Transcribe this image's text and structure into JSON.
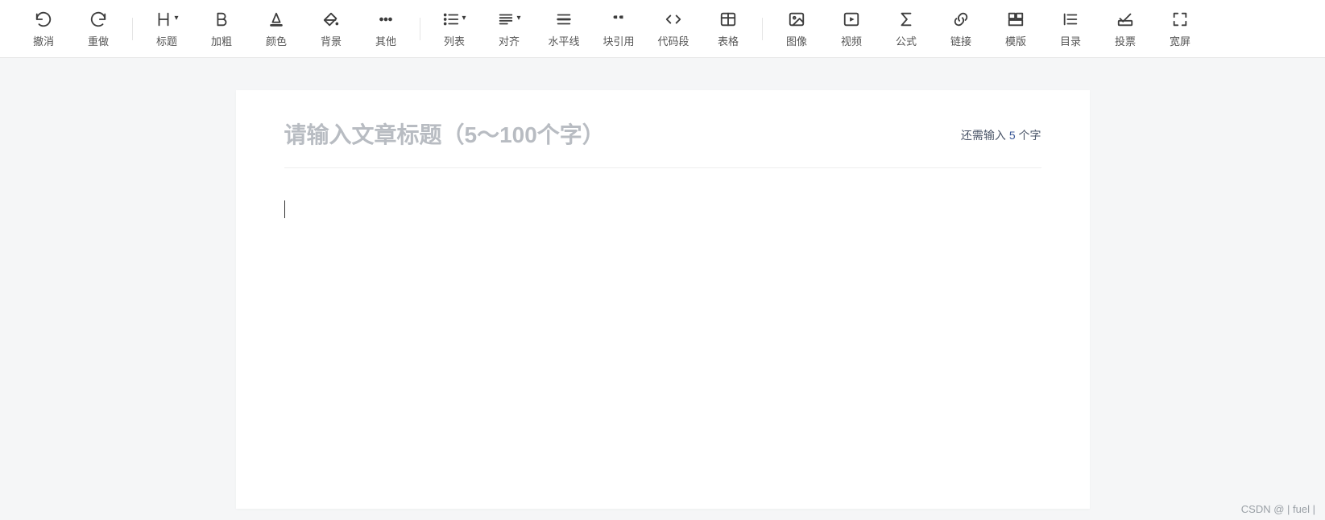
{
  "toolbar": {
    "groups": [
      [
        {
          "id": "undo",
          "label": "撤消",
          "icon": "undo"
        },
        {
          "id": "redo",
          "label": "重做",
          "icon": "redo"
        }
      ],
      [
        {
          "id": "heading",
          "label": "标题",
          "icon": "heading",
          "dropdown": true
        },
        {
          "id": "bold",
          "label": "加粗",
          "icon": "bold"
        },
        {
          "id": "color",
          "label": "颜色",
          "icon": "font-color"
        },
        {
          "id": "bg",
          "label": "背景",
          "icon": "paint-bucket"
        },
        {
          "id": "other",
          "label": "其他",
          "icon": "more"
        }
      ],
      [
        {
          "id": "list",
          "label": "列表",
          "icon": "list",
          "dropdown": true
        },
        {
          "id": "align",
          "label": "对齐",
          "icon": "align",
          "dropdown": true
        },
        {
          "id": "hr",
          "label": "水平线",
          "icon": "hr"
        },
        {
          "id": "quote",
          "label": "块引用",
          "icon": "quote"
        },
        {
          "id": "code",
          "label": "代码段",
          "icon": "code"
        },
        {
          "id": "table",
          "label": "表格",
          "icon": "table"
        }
      ],
      [
        {
          "id": "image",
          "label": "图像",
          "icon": "image"
        },
        {
          "id": "video",
          "label": "视频",
          "icon": "video"
        },
        {
          "id": "formula",
          "label": "公式",
          "icon": "sigma"
        },
        {
          "id": "link",
          "label": "链接",
          "icon": "link"
        },
        {
          "id": "template",
          "label": "模版",
          "icon": "template"
        },
        {
          "id": "toc",
          "label": "目录",
          "icon": "toc"
        },
        {
          "id": "vote",
          "label": "投票",
          "icon": "vote"
        },
        {
          "id": "fullscreen",
          "label": "宽屏",
          "icon": "expand"
        }
      ]
    ]
  },
  "editor": {
    "title_placeholder": "请输入文章标题（5～100个字）",
    "title_value": "",
    "counter_prefix": "还需输入 ",
    "counter_number": "5",
    "counter_suffix": " 个字",
    "content_value": ""
  },
  "watermark": "CSDN @ | fuel |"
}
